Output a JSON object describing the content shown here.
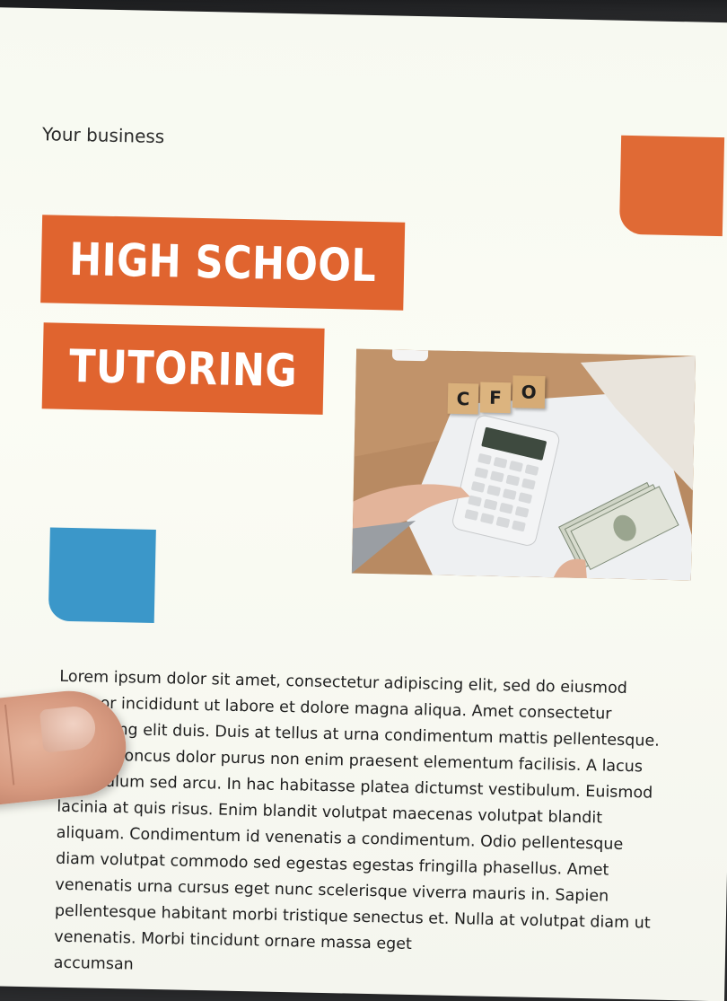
{
  "overline": "Your business",
  "title": {
    "line1": "HIGH SCHOOL",
    "line2": "TUTORING"
  },
  "photo": {
    "blocks": [
      "C",
      "F",
      "O"
    ]
  },
  "body_lines": [
    "Lorem ipsum dolor sit amet, consectetur adipiscing elit, sed do eiusmod",
    "tempor incididunt ut labore et dolore magna aliqua. Amet consectetur",
    "adipiscing elit duis. Duis at tellus at urna condimentum mattis pellentesque.",
    "Tortor rhoncus dolor purus non enim praesent elementum facilisis. A lacus",
    "vestibulum sed arcu. In hac habitasse platea dictumst vestibulum. Euismod",
    "lacinia at quis risus. Enim blandit volutpat maecenas volutpat blandit",
    "aliquam. Condimentum id venenatis a condimentum. Odio pellentesque",
    "diam volutpat commodo sed egestas egestas fringilla phasellus. Amet",
    "venenatis urna cursus eget nunc scelerisque viverra mauris in. Sapien",
    "pellentesque habitant morbi tristique senectus et. Nulla at volutpat diam ut",
    "venenatis. Morbi tincidunt ornare massa eget",
    "accumsan"
  ],
  "colors": {
    "accent_orange": "#e0642f",
    "accent_blue": "#3b97c9",
    "paper": "#f7f9f1"
  }
}
